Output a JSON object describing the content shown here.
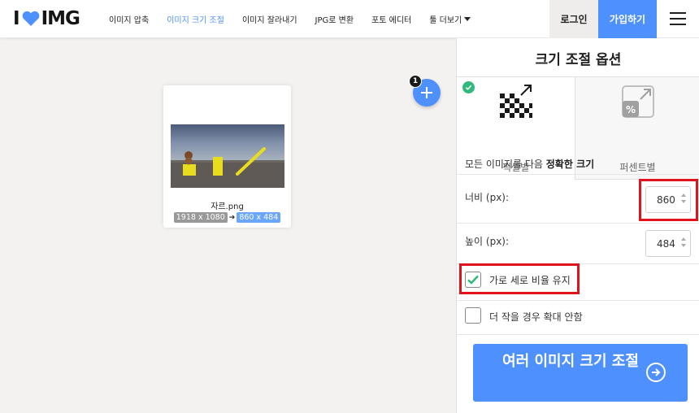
{
  "header": {
    "logo_left": "I",
    "logo_right": "IMG",
    "nav": [
      {
        "label": "이미지 압축"
      },
      {
        "label": "이미지 크기 조절"
      },
      {
        "label": "이미지 잘라내기"
      },
      {
        "label": "JPG로 변환"
      },
      {
        "label": "포토 에디터"
      },
      {
        "label": "툴 더보기"
      }
    ],
    "login_label": "로그인",
    "signup_label": "가입하기",
    "colors": {
      "accent": "#4d90fe",
      "logo_heart": "#4d90fe"
    }
  },
  "workspace": {
    "file": {
      "name": "자르.png",
      "original_dims": "1918 x 1080",
      "new_dims": "860 x 484"
    },
    "add_button_icon": "plus-icon",
    "file_count": "1"
  },
  "sidebar": {
    "title": "크기 조절 옵션",
    "tabs": [
      {
        "label": "픽셀별",
        "icon": "pixel-resize-icon",
        "selected": true
      },
      {
        "label": "퍼센트별",
        "icon": "percent-resize-icon",
        "selected": false
      }
    ],
    "section_head_prefix": "모든 이미지를 다음 ",
    "section_head_bold": "정확한 크기",
    "width": {
      "label": "너비 (px):",
      "value": "860"
    },
    "height": {
      "label": "높이 (px):",
      "value": "484"
    },
    "keep_ratio": {
      "label": "가로 세로 비율 유지",
      "checked": true
    },
    "no_enlarge": {
      "label": "더 작을 경우 확대 안함",
      "checked": false
    },
    "cta_label": "여러 이미지 크기 조절",
    "highlight_color": "#e0121b"
  }
}
